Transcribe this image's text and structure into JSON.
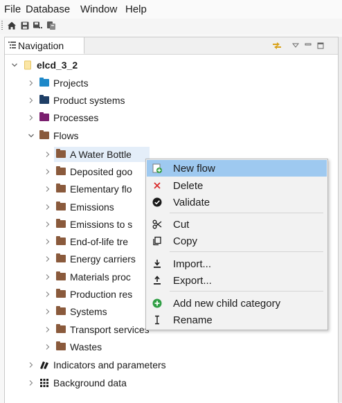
{
  "menubar": [
    "File",
    "Database",
    "Window",
    "Help"
  ],
  "view": {
    "tab_label": "Navigation"
  },
  "tree": {
    "root": "elcd_3_2",
    "projects": "Projects",
    "product_systems": "Product systems",
    "processes": "Processes",
    "flows": "Flows",
    "flow_categories": [
      "A Water Bottle",
      "Deposited goo",
      "Elementary flo",
      "Emissions",
      "Emissions to s",
      "End-of-life tre",
      "Energy carriers",
      "Materials proc",
      "Production res",
      "Systems",
      "Transport services",
      "Wastes"
    ],
    "indicators": "Indicators and parameters",
    "background": "Background data"
  },
  "context_menu": {
    "items": [
      {
        "label": "New flow",
        "icon": "new-flow-icon",
        "highlighted": true
      },
      {
        "label": "Delete",
        "icon": "delete-x-icon"
      },
      {
        "label": "Validate",
        "icon": "validate-check-icon"
      },
      {
        "label": "Cut",
        "icon": "cut-scissors-icon"
      },
      {
        "label": "Copy",
        "icon": "copy-icon"
      },
      {
        "label": "Import...",
        "icon": "import-icon"
      },
      {
        "label": "Export...",
        "icon": "export-icon"
      },
      {
        "label": "Add new child category",
        "icon": "add-green-plus-icon"
      },
      {
        "label": "Rename",
        "icon": "rename-cursor-icon"
      }
    ]
  },
  "colors": {
    "projects_folder": "#1e88c8",
    "product_systems_folder": "#1f3f66",
    "processes_folder": "#7a1f6e",
    "flows_folder": "#8a5a3c",
    "menu_highlight": "#9ec9f0",
    "selection": "#e4eef9"
  }
}
